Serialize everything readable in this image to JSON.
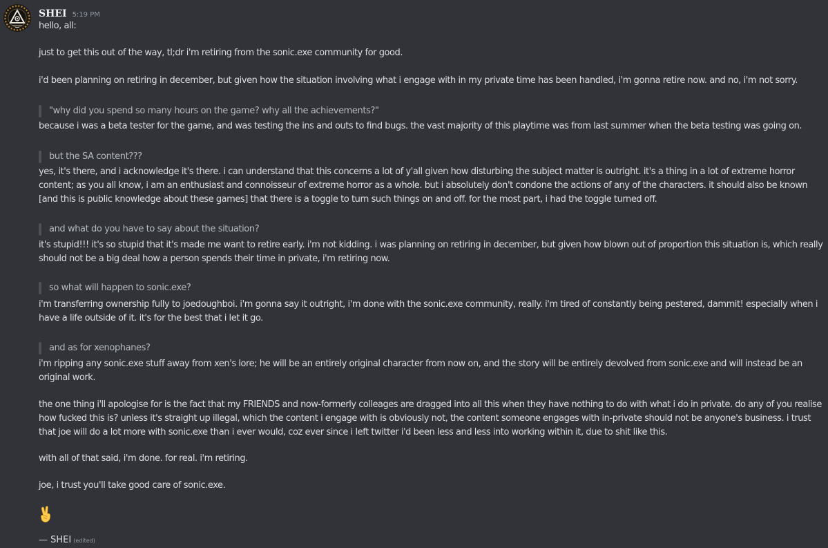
{
  "message": {
    "author": "SHEI",
    "timestamp": "5:19 PM",
    "lines": [
      "hello, all:",
      "just to get this out of the way, tl;dr i'm retiring from the sonic.exe community for good.",
      "i'd been planning on retiring in december, but given how the situation involving what i engage with in my private time has been handled, i'm gonna retire now. and no, i'm not sorry.",
      "because i was a beta tester for the game, and was testing the ins and outs to find bugs. the vast majority of this playtime was from last summer when the beta testing was going on.",
      "yes, it's there, and i acknowledge it's there. i can understand that this concerns a lot of y'all given how disturbing the subject matter is outright. it's a thing in a lot of extreme horror",
      "content; as you all know, i am an enthusiast and connoisseur of extreme horror as a whole. but i absolutely don't condone the actions of any of the characters. it should also be known",
      "[and this is public knowledge about these games] that there is a toggle to turn such things on and off. for the most part, i had the toggle turned off.",
      "it's stupid!!! it's so stupid that it's made me want to retire early. i'm not kidding. i was planning on retiring in december, but given how blown out of proportion this situation is, which really",
      "should not be a big deal how a person spends their time in private, i'm retiring now.",
      "i'm transferring ownership fully to joedoughboi. i'm gonna say it outright, i'm done with the sonic.exe community, really. i'm tired of constantly being pestered, dammit! especially when i",
      "have a life outside of it. it's for the best that i let it go.",
      "i'm ripping any sonic.exe stuff away from xen's lore; he will be an entirely original character from now on, and the story will be entirely devolved from sonic.exe and will instead be an",
      "original work.",
      "the one thing i'll apologise for is the fact that my FRIENDS and now-formerly colleages are dragged into all this when they have nothing to do with what i do in private. do any of you realise",
      "how fucked this is? unless it's straight up illegal, which the content i engage with is obviously not, the content someone engages with in-private should not be anyone's business. i trust",
      "that joe will do a lot more with sonic.exe than i ever would, coz ever since i left twitter i'd been less and less into working within it, due to shit like this.",
      "with all of that said, i'm done. for real. i'm retiring.",
      "joe, i trust you'll take good care of sonic.exe."
    ],
    "quotes": [
      "\"why did you spend so many hours on the game? why all the achievements?\"",
      "but the SA content???",
      "and what do you have to say about the situation?",
      "so what will happen to sonic.exe?",
      "and as for xenophanes?"
    ],
    "emoji": "victory-hand-emoji",
    "signature": "— SHEI",
    "edited_label": "(edited)"
  },
  "colors": {
    "background": "#313338",
    "text": "#dbdee1",
    "quote_text": "#b5bac1",
    "quote_bar": "#4e5058",
    "muted": "#949ba4",
    "username": "#f2f3f5"
  }
}
